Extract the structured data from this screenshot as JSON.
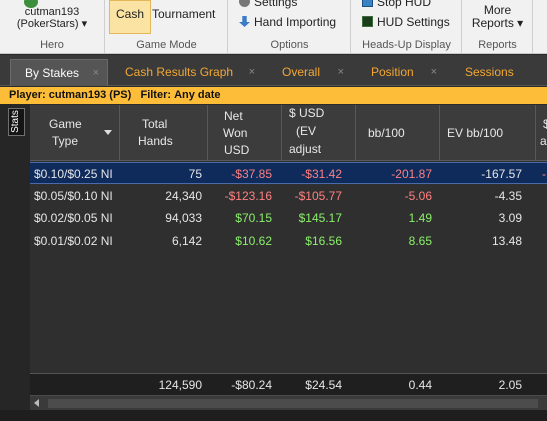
{
  "ribbon": {
    "hero_user": "cutman193",
    "hero_site": "(PokerStars) ▾",
    "hero_caption": "Hero",
    "cash_label": "Cash",
    "tournament_label": "Tournament",
    "game_mode_caption": "Game Mode",
    "settings_label": "Settings",
    "hand_importing_label": "Hand Importing",
    "options_caption": "Options",
    "stop_hud_label": "Stop HUD",
    "hud_settings_label": "HUD Settings",
    "hud_caption": "Heads-Up Display",
    "more_label": "More",
    "reports_label": "Reports ▾",
    "reports_caption": "Reports"
  },
  "tabs": [
    {
      "label": "By Stakes",
      "active": true
    },
    {
      "label": "Cash Results Graph",
      "active": false
    },
    {
      "label": "Overall",
      "active": false
    },
    {
      "label": "Position",
      "active": false
    },
    {
      "label": "Sessions",
      "active": false
    }
  ],
  "tab_close": "×",
  "filter": {
    "player_label": "Player:",
    "player_value": "cutman193 (PS)",
    "filter_label": "Filter:",
    "filter_value": "Any date"
  },
  "stats_tab": "Stats",
  "columns": {
    "game_type": [
      "Game",
      "Type"
    ],
    "total_hands": [
      "Total",
      "Hands"
    ],
    "net_won": [
      "Net",
      "Won",
      "USD"
    ],
    "ev_adjusted": [
      "$ USD",
      "(EV",
      "adjust"
    ],
    "bb100": "bb/100",
    "ev_bb100": "EV bb/100",
    "overflow": [
      "$",
      "a"
    ]
  },
  "rows": [
    {
      "game_type": "$0.10/$0.25 NI",
      "total_hands": "75",
      "net_won": "-$37.85",
      "ev_adjusted": "-$31.42",
      "bb100": "-201.87",
      "ev_bb100": "-167.57",
      "extra": "-",
      "selected": true
    },
    {
      "game_type": "$0.05/$0.10 NI",
      "total_hands": "24,340",
      "net_won": "-$123.16",
      "ev_adjusted": "-$105.77",
      "bb100": "-5.06",
      "ev_bb100": "-4.35",
      "extra": "",
      "selected": false
    },
    {
      "game_type": "$0.02/$0.05 NI",
      "total_hands": "94,033",
      "net_won": "$70.15",
      "ev_adjusted": "$145.17",
      "bb100": "1.49",
      "ev_bb100": "3.09",
      "extra": "",
      "selected": false
    },
    {
      "game_type": "$0.01/$0.02 NI",
      "total_hands": "6,142",
      "net_won": "$10.62",
      "ev_adjusted": "$16.56",
      "bb100": "8.65",
      "ev_bb100": "13.48",
      "extra": "",
      "selected": false
    }
  ],
  "totals": {
    "total_hands": "124,590",
    "net_won": "-$80.24",
    "ev_adjusted": "$24.54",
    "bb100": "0.44",
    "ev_bb100": "2.05"
  },
  "colors": {
    "positive": "#8bf06a",
    "negative": "#ff8080",
    "tab_text": "#f3a733",
    "filter_bar": "#fdbd39",
    "selected_row": "#0f2b5c"
  }
}
